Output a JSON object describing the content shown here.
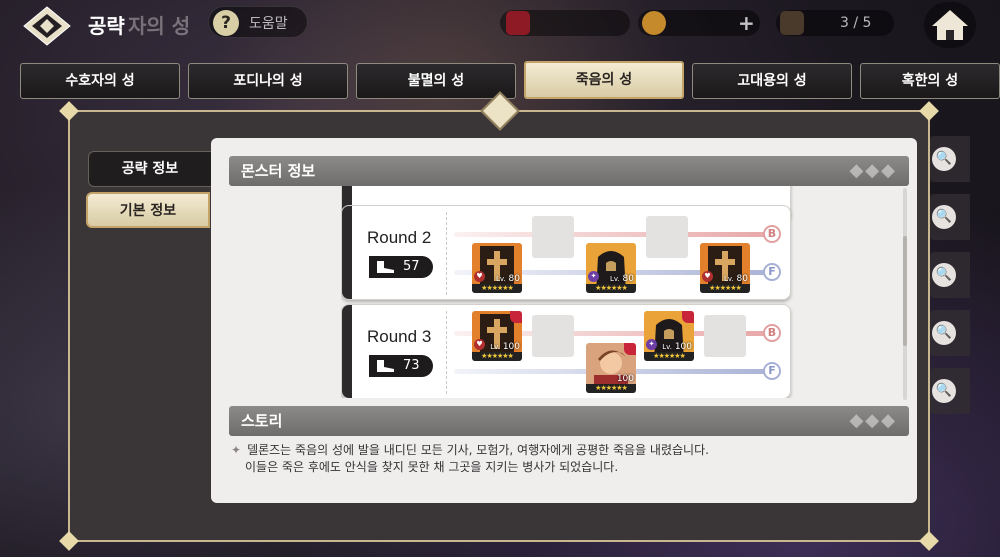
{
  "header": {
    "title": "공략",
    "subtitle_ghost": "자의 성",
    "help_label": "도움말",
    "help_glyph": "?",
    "stamina_count": "3 / 5",
    "plus_glyph": "+"
  },
  "tabs": [
    {
      "label": "수호자의 성"
    },
    {
      "label": "포디나의 성"
    },
    {
      "label": "불멸의 성"
    },
    {
      "label": "죽음의 성",
      "active": true
    },
    {
      "label": "고대용의 성"
    },
    {
      "label": "혹한의 성"
    }
  ],
  "side_tabs": [
    {
      "label": "공략 정보"
    },
    {
      "label": "기본 정보",
      "active": true
    }
  ],
  "monster_section": {
    "title": "몬스터 정보",
    "decor": "◆◆◆",
    "lane_back_tag": "B",
    "lane_front_tag": "F",
    "rounds": [
      {
        "label": "Round 2",
        "power": "57",
        "units": [
          {
            "level": "80",
            "lv_prefix": "Lv.",
            "stars": "★★★★★★",
            "badge": "♥",
            "kind": "cross"
          },
          {
            "level": "80",
            "lv_prefix": "Lv.",
            "stars": "★★★★★★",
            "badge": "✦",
            "kind": "hood"
          },
          {
            "level": "80",
            "lv_prefix": "Lv.",
            "stars": "★★★★★★",
            "badge": "♥",
            "kind": "cross"
          }
        ]
      },
      {
        "label": "Round 3",
        "power": "73",
        "units": [
          {
            "level": "100",
            "lv_prefix": "Lv.",
            "stars": "★★★★★★",
            "badge": "♥",
            "kind": "cross"
          },
          {
            "level": "100",
            "lv_prefix": "Lv.",
            "stars": "★★★★★★",
            "badge": "✦",
            "kind": "hood"
          },
          {
            "level": "100",
            "lv_prefix": "",
            "stars": "★★★★★★",
            "badge": "",
            "kind": "warrior"
          }
        ]
      }
    ]
  },
  "story_section": {
    "title": "스토리",
    "decor": "◆◆◆",
    "bullet": "✦",
    "line1": "델론즈는 죽음의 성에 발을 내디딘 모든 기사, 모험가, 여행자에게 공평한 죽음을 내렸습니다.",
    "line2": "이들은 죽은 후에도 안식을 찾지 못한 채 그곳을 지키는 병사가 되었습니다."
  },
  "colors": {
    "accent_gold": "#c9b88f",
    "active_tab": "#efe5c8",
    "back_lane": "#e7a7a7",
    "front_lane": "#aab3d6"
  },
  "icons": [
    "logo-diamond-icon",
    "home-icon",
    "search-icon",
    "boot-icon",
    "cross-emblem-icon"
  ]
}
